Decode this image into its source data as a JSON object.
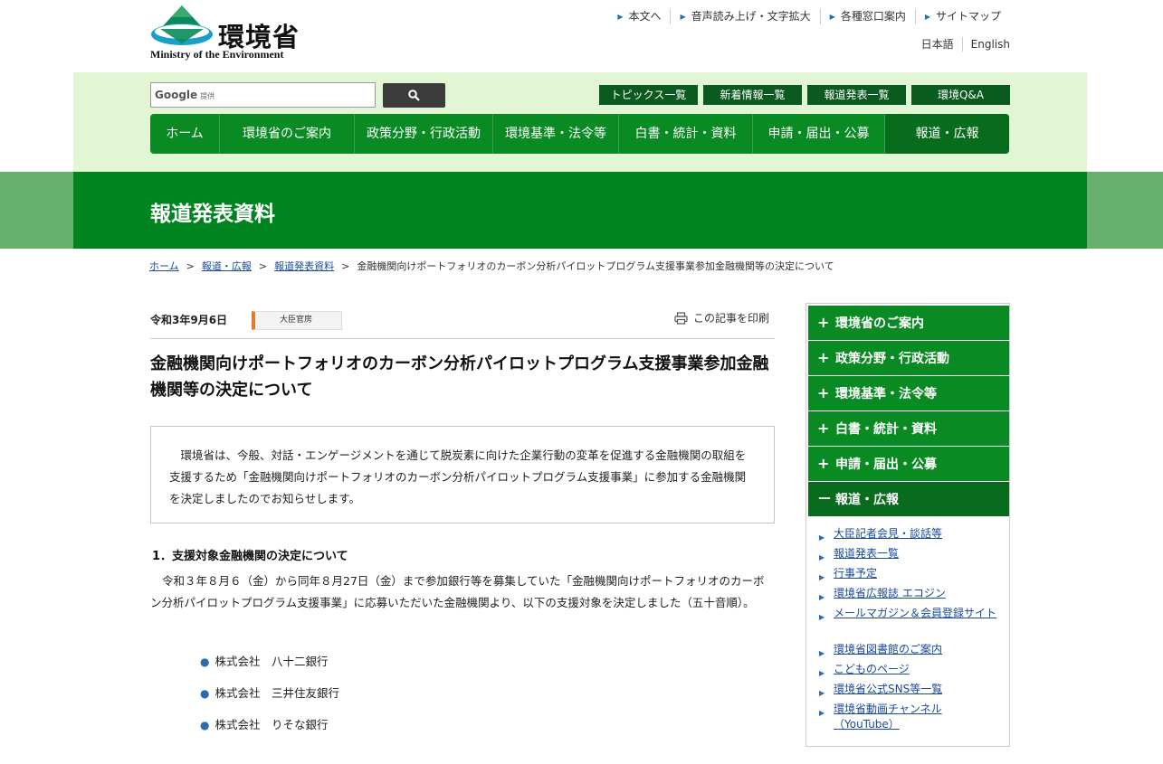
{
  "header": {
    "logo_ja": "環境省",
    "logo_en": "Ministry of the Environment",
    "util_links": [
      "本文へ",
      "音声読み上げ・文字拡大",
      "各種窓口案内",
      "サイトマップ"
    ],
    "lang_links": [
      "日本語",
      "English"
    ]
  },
  "search": {
    "brand": "Google",
    "brand_suffix": "提供",
    "button_icon": "search-icon"
  },
  "quick_links": [
    "トピックス一覧",
    "新着情報一覧",
    "報道発表一覧",
    "環境Q&A"
  ],
  "global_nav": [
    "ホーム",
    "環境省のご案内",
    "政策分野・行政活動",
    "環境基準・法令等",
    "白書・統計・資料",
    "申請・届出・公募",
    "報道・広報"
  ],
  "banner": {
    "title": "報道発表資料"
  },
  "breadcrumb": {
    "items": [
      "ホーム",
      "報道・広報",
      "報道発表資料"
    ],
    "separator": ">",
    "current": "金融機関向けポートフォリオのカーボン分析パイロットプログラム支援事業参加金融機関等の決定について"
  },
  "article": {
    "date": "令和3年9月6日",
    "department": "大臣官房",
    "print_label": "この記事を印刷",
    "title": "金融機関向けポートフォリオのカーボン分析パイロットプログラム支援事業参加金融機関等の決定について",
    "lead": "　環境省は、今般、対話・エンゲージメントを通じて脱炭素に向けた企業行動の変革を促進する金融機関の取組を支援するため「金融機関向けポートフォリオのカーボン分析パイロットプログラム支援事業」に参加する金融機関を決定しましたのでお知らせします。",
    "section_heading": "1．支援対象金融機関の決定について",
    "section_body": "令和３年８月６（金）から同年８月27日（金）まで参加銀行等を募集していた「金融機関向けポートフォリオのカーボン分析パイロットプログラム支援事業」に応募いただいた金融機関より、以下の支援対象を決定しました（五十音順）。",
    "banks": [
      "株式会社　八十二銀行",
      "株式会社　三井住友銀行",
      "株式会社　りそな銀行"
    ]
  },
  "sidebar": {
    "categories": [
      {
        "sign": "+",
        "label": "環境省のご案内"
      },
      {
        "sign": "+",
        "label": "政策分野・行政活動"
      },
      {
        "sign": "+",
        "label": "環境基準・法令等"
      },
      {
        "sign": "+",
        "label": "白書・統計・資料"
      },
      {
        "sign": "+",
        "label": "申請・届出・公募"
      },
      {
        "sign": "－",
        "label": "報道・広報"
      }
    ],
    "links": [
      "大臣記者会見・談話等",
      "報道発表一覧",
      "行事予定",
      "環境省広報誌 エコジン",
      "メールマガジン＆会員登録サイト",
      "環境省図書館のご案内",
      "こどものページ",
      "環境省公式SNS等一覧",
      "環境省動画チャンネル（YouTube）"
    ]
  },
  "colors": {
    "brand_green": "#0a8a23",
    "dark_green": "#076c1b",
    "band_light_green": "#e2f6d6",
    "banner_green": "#00841f",
    "link_blue": "#1a4a9a",
    "dept_accent": "#e47a2e"
  }
}
